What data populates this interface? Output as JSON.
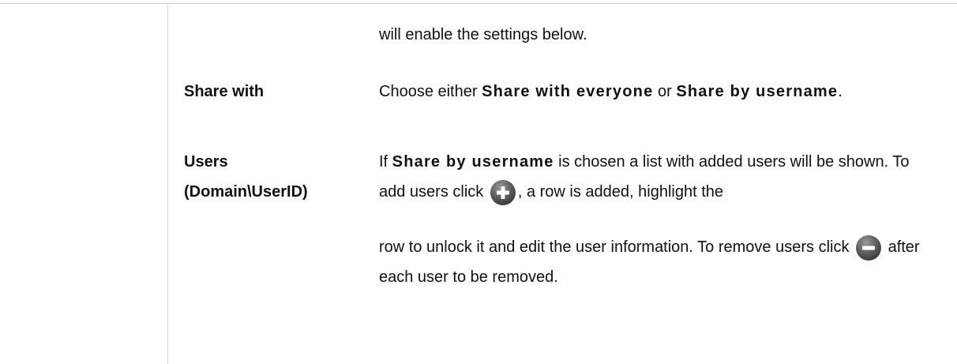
{
  "intro": {
    "text": "will enable the settings below."
  },
  "rows": [
    {
      "label": "Share with",
      "desc": {
        "p1": "Choose either ",
        "kw1": "Share with everyone",
        "p2": " or ",
        "kw2": "Share by username",
        "p3": "."
      }
    },
    {
      "label_line1": "Users",
      "label_line2": "(Domain\\UserID)",
      "desc": {
        "p1": "If ",
        "kw1": "Share by username",
        "p2": " is chosen a list with added users will be shown. To add users click ",
        "p3": ", a row is added, highlight the",
        "p4": "row to unlock it and edit the user information. To remove users click ",
        "p5": " after each user to be removed."
      },
      "icons": {
        "add": "add-user-icon",
        "remove": "remove-user-icon"
      }
    }
  ]
}
